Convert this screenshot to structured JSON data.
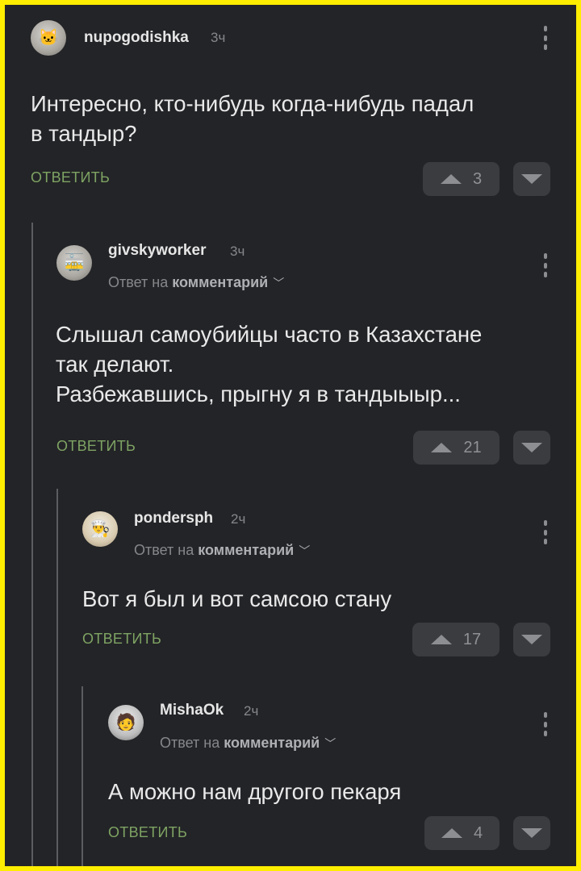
{
  "comments": [
    {
      "username": "nupogodishka",
      "time": "3ч",
      "body": "Интересно, кто-нибудь когда-нибудь падал\nв тандыр?",
      "reply_label": "ОТВЕТИТЬ",
      "votes": "3"
    },
    {
      "username": "givskyworker",
      "time": "3ч",
      "reply_prefix": "Ответ на",
      "reply_target": "комментарий",
      "body": "Слышал самоубийцы часто в Казахстане\nтак делают.\nРазбежавшись, прыгну я в тандыыыр...",
      "reply_label": "ОТВЕТИТЬ",
      "votes": "21"
    },
    {
      "username": "pondersph",
      "time": "2ч",
      "reply_prefix": "Ответ на",
      "reply_target": "комментарий",
      "body": "Вот я был и вот самсою стану",
      "reply_label": "ОТВЕТИТЬ",
      "votes": "17"
    },
    {
      "username": "MishaOk",
      "time": "2ч",
      "reply_prefix": "Ответ на",
      "reply_target": "комментарий",
      "body": "А можно нам другого пекаря",
      "reply_label": "ОТВЕТИТЬ",
      "votes": "4"
    }
  ],
  "colors": {
    "border": "#ffee00",
    "background": "#232427",
    "reply_link": "#7ea363",
    "vote_button": "#3b3c40"
  }
}
